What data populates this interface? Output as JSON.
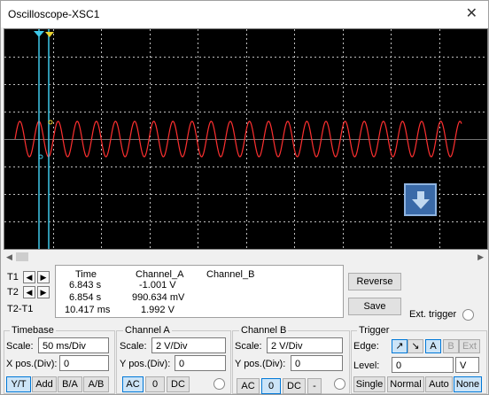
{
  "window": {
    "title": "Oscilloscope-XSC1",
    "close_glyph": "✕"
  },
  "readout": {
    "row_labels": [
      "T1",
      "T2",
      "T2-T1"
    ],
    "headers": [
      "Time",
      "Channel_A",
      "Channel_B"
    ],
    "rows": [
      {
        "time": "6.843 s",
        "channel_a": "-1.001 V",
        "channel_b": ""
      },
      {
        "time": "6.854 s",
        "channel_a": "990.634 mV",
        "channel_b": ""
      },
      {
        "time": "10.417 ms",
        "channel_a": "1.992 V",
        "channel_b": ""
      }
    ]
  },
  "buttons": {
    "reverse": "Reverse",
    "save": "Save"
  },
  "ext_trigger": "Ext. trigger",
  "timebase": {
    "title": "Timebase",
    "scale_label": "Scale:",
    "scale_value": "50 ms/Div",
    "xpos_label": "X pos.(Div):",
    "xpos_value": "0",
    "modes": [
      "Y/T",
      "Add",
      "B/A",
      "A/B"
    ],
    "active_mode": "Y/T"
  },
  "channel_a": {
    "title": "Channel A",
    "scale_label": "Scale:",
    "scale_value": "2  V/Div",
    "ypos_label": "Y pos.(Div):",
    "ypos_value": "0",
    "coupling": [
      "AC",
      "0",
      "DC"
    ],
    "active_coupling": "AC"
  },
  "channel_b": {
    "title": "Channel B",
    "scale_label": "Scale:",
    "scale_value": "2  V/Div",
    "ypos_label": "Y pos.(Div):",
    "ypos_value": "0",
    "coupling": [
      "AC",
      "0",
      "DC",
      "-"
    ],
    "active_coupling": "0"
  },
  "trigger": {
    "title": "Trigger",
    "edge_label": "Edge:",
    "level_label": "Level:",
    "level_value": "0",
    "level_unit": "V",
    "sources": [
      "A",
      "B",
      "Ext"
    ],
    "active_source": "A",
    "modes": [
      "Single",
      "Normal",
      "Auto",
      "None"
    ],
    "active_mode": "None"
  },
  "colors": {
    "screen_bg": "#000000",
    "trace_a": "#ff3030",
    "cursor": "#3fc8e8",
    "grid": "#ffffff"
  }
}
